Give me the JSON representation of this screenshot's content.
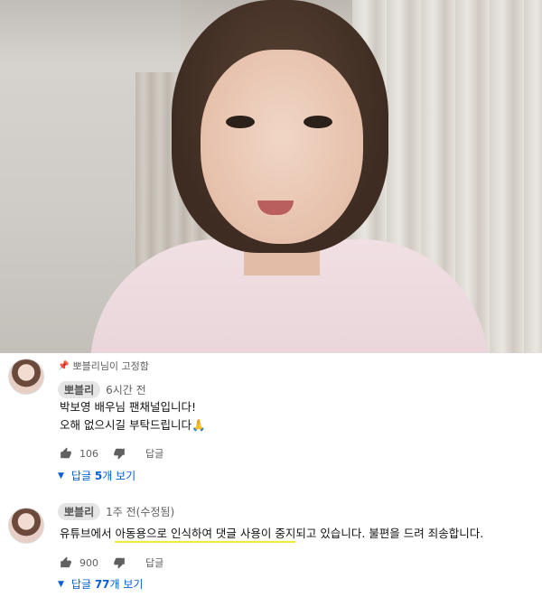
{
  "comments": [
    {
      "pinned_label": "뽀블리님이 고정함",
      "author": "뽀블리",
      "time": "6시간 전",
      "text_lines": [
        "박보영 배우님 팬채널입니다!",
        "오해 없으시길 부탁드립니다🙏"
      ],
      "likes": "106",
      "reply_label": "답글",
      "view_replies": {
        "prefix": "답글 ",
        "count": "5",
        "suffix": "개 보기"
      }
    },
    {
      "author": "뽀블리",
      "time": "1주 전(수정됨)",
      "text": {
        "before": "유튜브에서 ",
        "highlighted": "아동용으로 인식하여 댓글 사용이 중지",
        "after": "되고 있습니다. 불편을 드려 죄송합니다."
      },
      "likes": "900",
      "reply_label": "답글",
      "view_replies": {
        "prefix": "답글 ",
        "count": "77",
        "suffix": "개 보기"
      }
    }
  ],
  "icons": {
    "pin": "pin-icon",
    "like": "thumbs-up-icon",
    "dislike": "thumbs-down-icon",
    "expand": "caret-down-icon"
  },
  "colors": {
    "link_blue": "#065fd4",
    "highlight_yellow": "#f4e83b",
    "meta_gray": "#606060"
  }
}
